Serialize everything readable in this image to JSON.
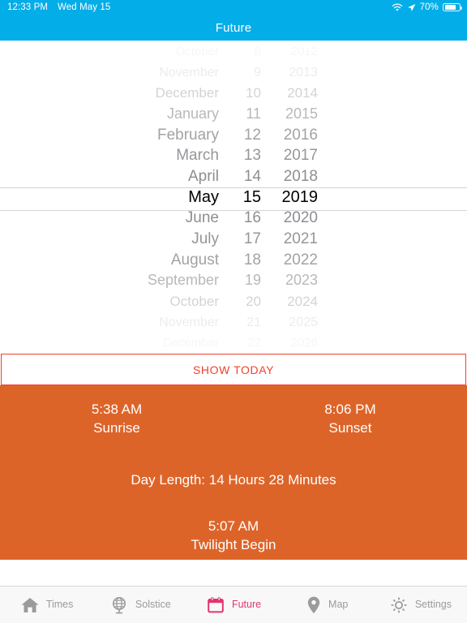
{
  "statusbar": {
    "time": "12:33 PM",
    "date": "Wed May 15",
    "battery_percent": "70%",
    "wifi_icon": "wifi-icon",
    "location_icon": "location-arrow-icon",
    "battery_icon": "battery-icon"
  },
  "navbar": {
    "title": "Future"
  },
  "picker": {
    "selected": {
      "month": "May",
      "day": "15",
      "year": "2019"
    },
    "rows": [
      {
        "month": "October",
        "day": "8",
        "year": "2012",
        "fade": "f6"
      },
      {
        "month": "November",
        "day": "9",
        "year": "2013",
        "fade": "f5"
      },
      {
        "month": "December",
        "day": "10",
        "year": "2014",
        "fade": "f4"
      },
      {
        "month": "January",
        "day": "11",
        "year": "2015",
        "fade": "f3"
      },
      {
        "month": "February",
        "day": "12",
        "year": "2016",
        "fade": "f2"
      },
      {
        "month": "March",
        "day": "13",
        "year": "2017",
        "fade": "f1"
      },
      {
        "month": "April",
        "day": "14",
        "year": "2018",
        "fade": "f0"
      },
      {
        "month": "May",
        "day": "15",
        "year": "2019",
        "fade": "sel"
      },
      {
        "month": "June",
        "day": "16",
        "year": "2020",
        "fade": "f0"
      },
      {
        "month": "July",
        "day": "17",
        "year": "2021",
        "fade": "f1"
      },
      {
        "month": "August",
        "day": "18",
        "year": "2022",
        "fade": "f2"
      },
      {
        "month": "September",
        "day": "19",
        "year": "2023",
        "fade": "f3"
      },
      {
        "month": "October",
        "day": "20",
        "year": "2024",
        "fade": "f4"
      },
      {
        "month": "November",
        "day": "21",
        "year": "2025",
        "fade": "f5"
      },
      {
        "month": "December",
        "day": "22",
        "year": "2026",
        "fade": "f6"
      }
    ]
  },
  "show_today_button": {
    "label": "SHOW TODAY",
    "color": "#f2402c"
  },
  "info": {
    "background_color": "#dd6429",
    "sunrise": {
      "time": "5:38 AM",
      "label": "Sunrise"
    },
    "sunset": {
      "time": "8:06 PM",
      "label": "Sunset"
    },
    "day_length": "Day Length: 14 Hours 28 Minutes",
    "twilight": {
      "time": "5:07 AM",
      "label": "Twilight Begin"
    }
  },
  "tabbar": {
    "active_color": "#e0366d",
    "inactive_color": "#9b9b9b",
    "items": [
      {
        "label": "Times",
        "icon": "home-icon",
        "active": false
      },
      {
        "label": "Solstice",
        "icon": "globe-icon",
        "active": false
      },
      {
        "label": "Future",
        "icon": "calendar-icon",
        "active": true
      },
      {
        "label": "Map",
        "icon": "map-pin-icon",
        "active": false
      },
      {
        "label": "Settings",
        "icon": "gear-icon",
        "active": false
      }
    ]
  }
}
